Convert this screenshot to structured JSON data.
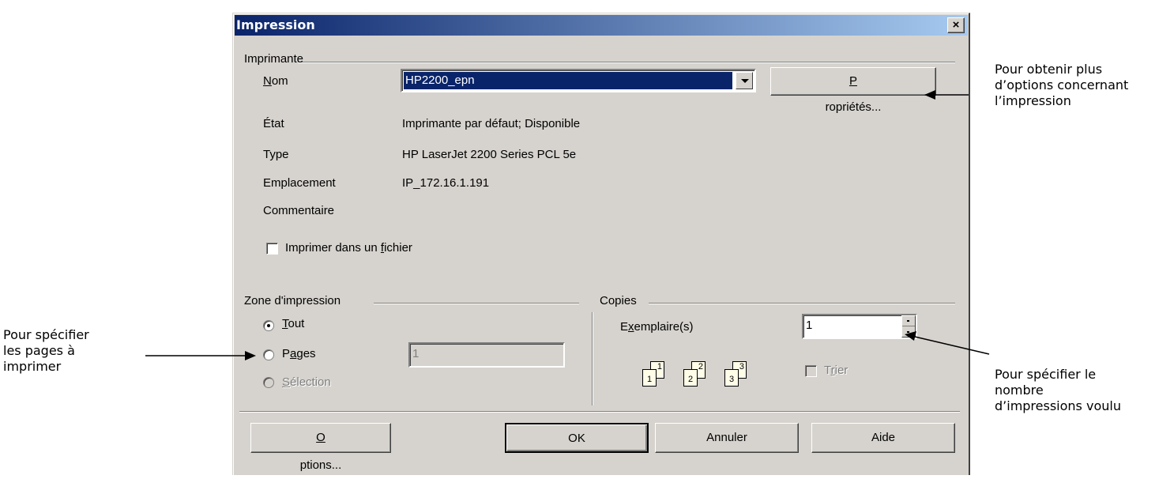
{
  "dialog": {
    "title": "Impression",
    "close_label": "×",
    "printer_group": "Imprimante",
    "name_label_pre": "",
    "name_label_u": "N",
    "name_label_post": "om",
    "printer_name": "HP2200_epn",
    "properties_u": "P",
    "properties_rest": "ropriétés...",
    "state_label": "État",
    "state_value": "Imprimante par défaut; Disponible",
    "type_label": "Type",
    "type_value": "HP LaserJet 2200 Series PCL 5e",
    "location_label": "Emplacement",
    "location_value": "IP_172.16.1.191",
    "comment_label": "Commentaire",
    "print_file_pre": "Imprimer dans un ",
    "print_file_u": "f",
    "print_file_post": "ichier",
    "zone_group": "Zone d'impression",
    "all_u": "T",
    "all_rest": "out",
    "pages_pre": "P",
    "pages_u": "a",
    "pages_post": "ges",
    "pages_value": "1",
    "selection_u": "S",
    "selection_rest": "élection",
    "copies_group": "Copies",
    "copies_pre": "E",
    "copies_u": "x",
    "copies_post": "emplaire(s)",
    "copies_value": "1",
    "collate_pre": "T",
    "collate_u": "r",
    "collate_post": "ier",
    "options_u": "O",
    "options_rest": "ptions...",
    "ok_label": "OK",
    "cancel_label": "Annuler",
    "help_label": "Aide"
  },
  "annotations": {
    "left": [
      "Pour spécifier",
      "les pages à",
      "imprimer"
    ],
    "right_top": [
      "Pour obtenir plus",
      "d’options concernant",
      "l’impression"
    ],
    "right_bottom": [
      "Pour spécifier le",
      "nombre",
      "d’impressions voulu"
    ]
  },
  "collate_illustration": {
    "stacks": [
      [
        "1",
        "1"
      ],
      [
        "2",
        "2"
      ],
      [
        "3",
        "3"
      ]
    ]
  }
}
